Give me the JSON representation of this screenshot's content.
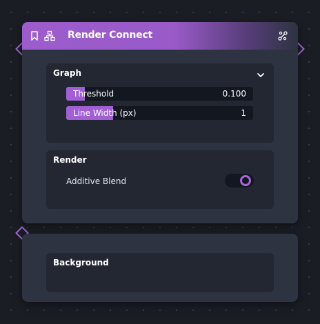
{
  "node": {
    "title": "Render Connect",
    "header_icons": [
      "bookmark-icon",
      "hierarchy-icon",
      "node-link-icon"
    ],
    "accent_color": "#a569d6"
  },
  "sections": {
    "graph": {
      "title": "Graph",
      "expanded": true,
      "threshold": {
        "label": "Threshold",
        "value": "0.100",
        "fill_fraction": 0.1
      },
      "line_width": {
        "label": "Line Width (px)",
        "value": "1",
        "fill_fraction": 0.25
      }
    },
    "render": {
      "title": "Render",
      "additive_blend": {
        "label": "Additive Blend",
        "on": true
      }
    }
  },
  "background_node": {
    "section_title": "Background"
  }
}
